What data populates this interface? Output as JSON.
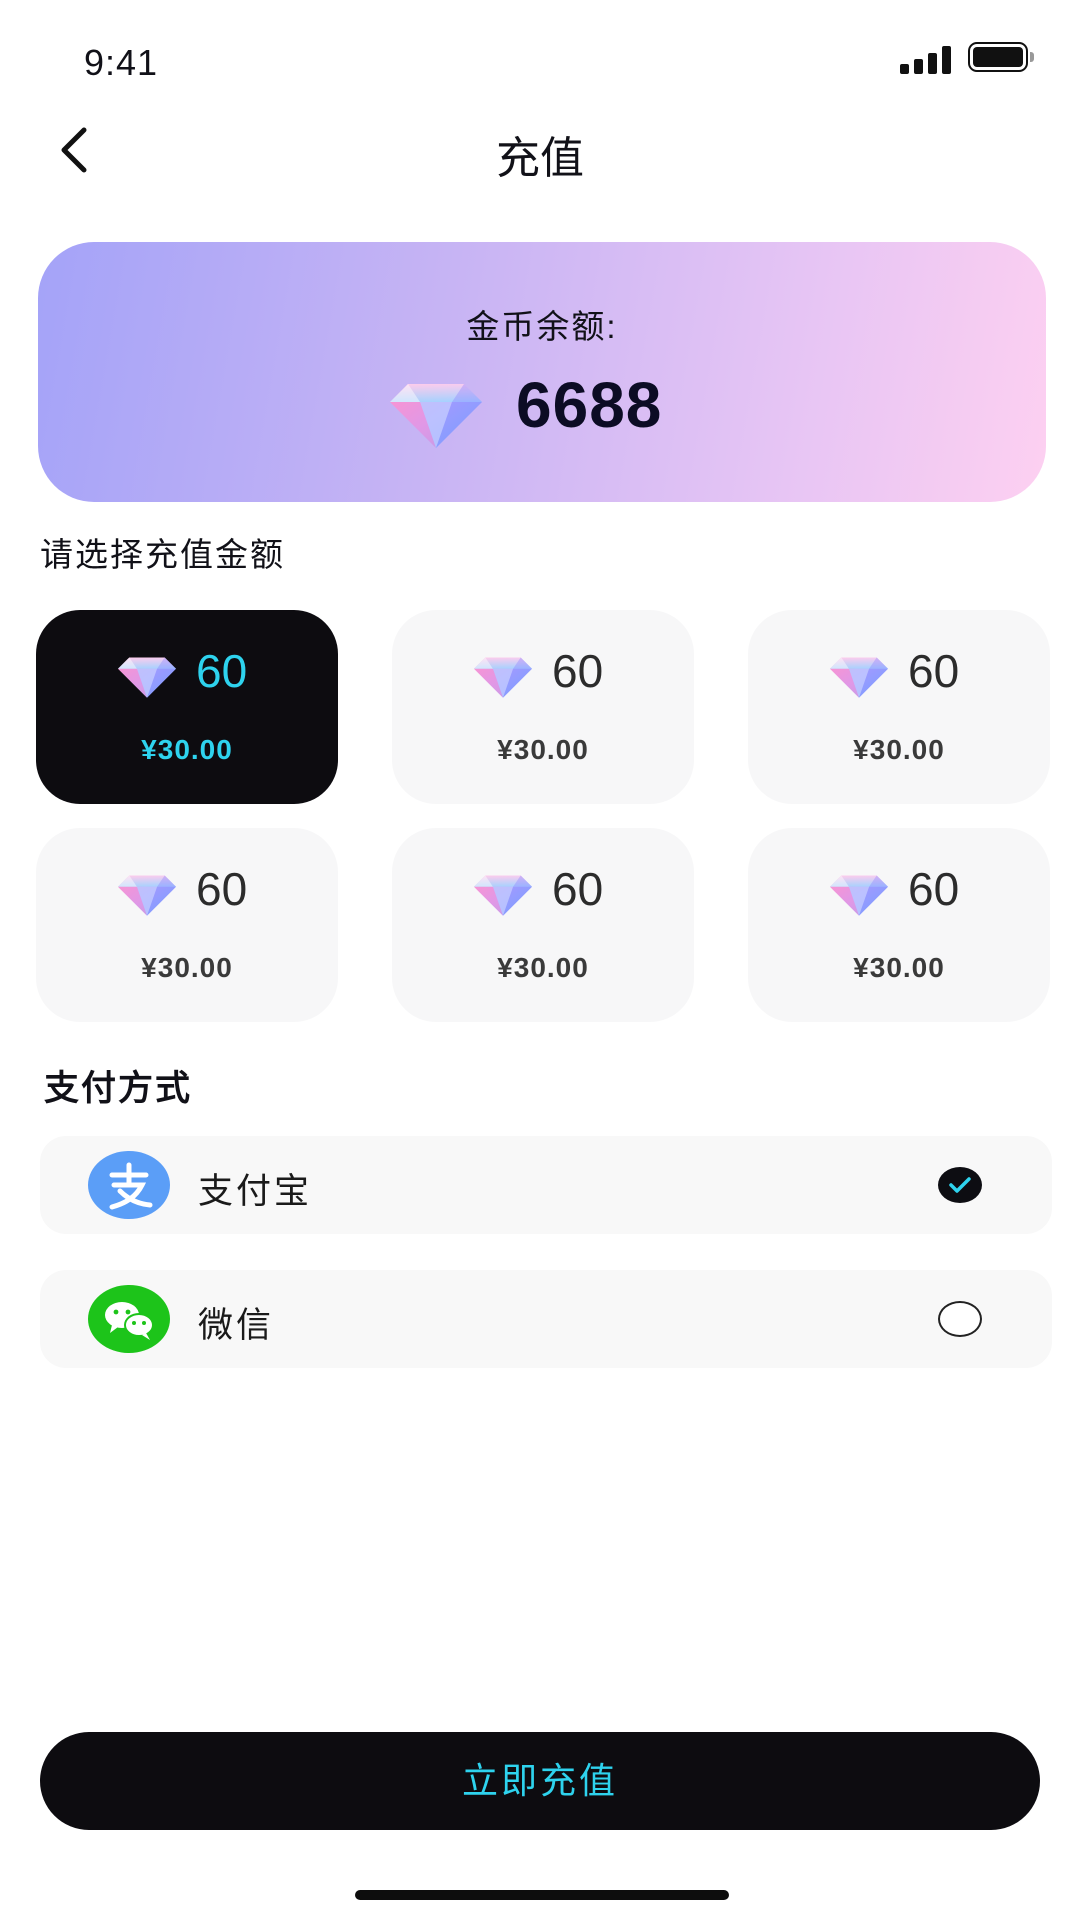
{
  "status_bar": {
    "time": "9:41"
  },
  "header": {
    "title": "充值",
    "back_icon": "chevron-left-icon"
  },
  "balance": {
    "label": "金币余额:",
    "value": "6688",
    "icon": "diamond-icon"
  },
  "amount_section": {
    "heading": "请选择充值金额"
  },
  "packages": [
    {
      "qty": "60",
      "price": "¥30.00",
      "selected": true
    },
    {
      "qty": "60",
      "price": "¥30.00",
      "selected": false
    },
    {
      "qty": "60",
      "price": "¥30.00",
      "selected": false
    },
    {
      "qty": "60",
      "price": "¥30.00",
      "selected": false
    },
    {
      "qty": "60",
      "price": "¥30.00",
      "selected": false
    },
    {
      "qty": "60",
      "price": "¥30.00",
      "selected": false
    }
  ],
  "payment": {
    "heading": "支付方式",
    "methods": [
      {
        "label": "支付宝",
        "icon": "alipay-icon",
        "selected": true
      },
      {
        "label": "微信",
        "icon": "wechat-icon",
        "selected": false
      }
    ]
  },
  "submit": {
    "label": "立即充值"
  },
  "colors": {
    "accent_cyan": "#2ED3EE",
    "dark": "#0D0C10",
    "alipay_blue": "#5B9EF7",
    "wechat_green": "#1DC41A",
    "card_gradient_start": "#A4A3F8",
    "card_gradient_end": "#FDD0F1"
  }
}
